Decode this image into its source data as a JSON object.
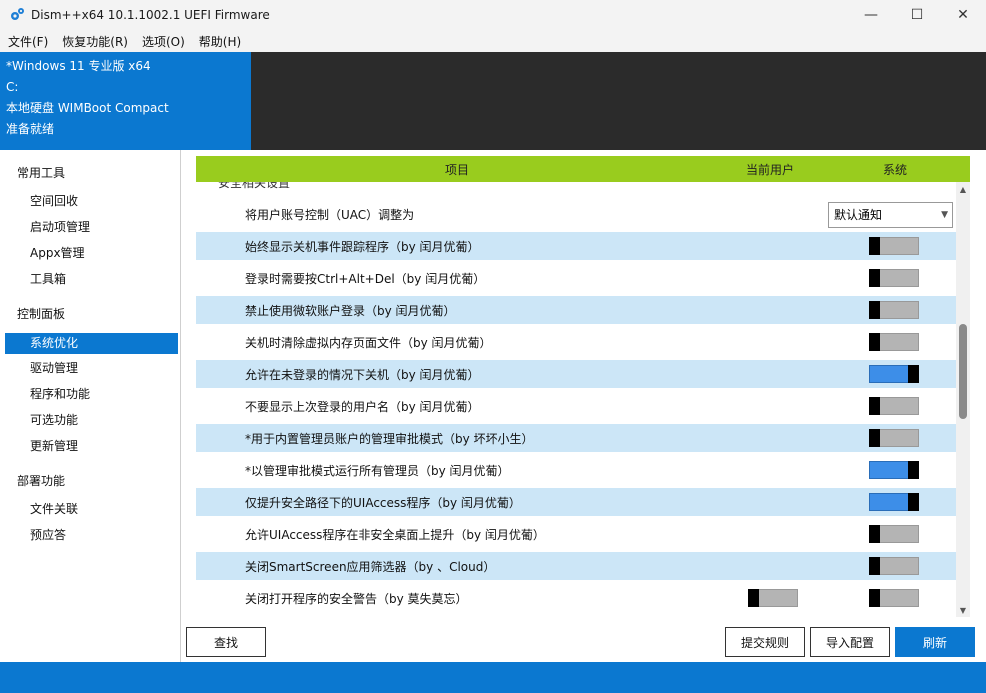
{
  "window": {
    "title": "Dism++x64 10.1.1002.1 UEFI Firmware",
    "minimize": "—",
    "maximize": "☐",
    "close": "✕"
  },
  "menu": [
    "文件(F)",
    "恢复功能(R)",
    "选项(O)",
    "帮助(H)"
  ],
  "info": {
    "os": "*Windows 11 专业版 x64",
    "drive": "C:",
    "disk": "本地硬盘 WIMBoot Compact",
    "status": "准备就绪"
  },
  "sidebar": {
    "groups": [
      {
        "label": "常用工具",
        "items": [
          "空间回收",
          "启动项管理",
          "Appx管理",
          "工具箱"
        ]
      },
      {
        "label": "控制面板",
        "items": [
          "系统优化",
          "驱动管理",
          "程序和功能",
          "可选功能",
          "更新管理"
        ]
      },
      {
        "label": "部署功能",
        "items": [
          "文件关联",
          "预应答"
        ]
      }
    ],
    "active": "系统优化"
  },
  "table": {
    "header": {
      "item": "项目",
      "user": "当前用户",
      "system": "系统"
    },
    "section": "安全相关设置",
    "rows": [
      {
        "label": "将用户账号控制（UAC）调整为",
        "type": "select",
        "value": "默认通知"
      },
      {
        "label": "始终显示关机事件跟踪程序（by 闰月优葡）",
        "system": "off"
      },
      {
        "label": "登录时需要按Ctrl+Alt+Del（by 闰月优葡）",
        "system": "off"
      },
      {
        "label": "禁止使用微软账户登录（by 闰月优葡）",
        "system": "off"
      },
      {
        "label": "关机时清除虚拟内存页面文件（by 闰月优葡）",
        "system": "off"
      },
      {
        "label": "允许在未登录的情况下关机（by 闰月优葡）",
        "system": "on"
      },
      {
        "label": "不要显示上次登录的用户名（by 闰月优葡）",
        "system": "off"
      },
      {
        "label": "*用于内置管理员账户的管理审批模式（by 坏坏小生）",
        "system": "off"
      },
      {
        "label": "*以管理审批模式运行所有管理员（by 闰月优葡）",
        "system": "on"
      },
      {
        "label": "仅提升安全路径下的UIAccess程序（by 闰月优葡）",
        "system": "on"
      },
      {
        "label": "允许UIAccess程序在非安全桌面上提升（by 闰月优葡）",
        "system": "off"
      },
      {
        "label": "关闭SmartScreen应用筛选器（by 、Cloud）",
        "system": "off"
      },
      {
        "label": "关闭打开程序的安全警告（by 莫失莫忘）",
        "user": "off",
        "system": "off"
      }
    ]
  },
  "buttons": {
    "find": "查找",
    "submit": "提交规则",
    "import": "导入配置",
    "refresh": "刷新"
  },
  "colors": {
    "accent": "#0b78d0",
    "header": "#99cc1e",
    "row_alt": "#cce6f7",
    "toggle_on": "#3d8ee8"
  }
}
